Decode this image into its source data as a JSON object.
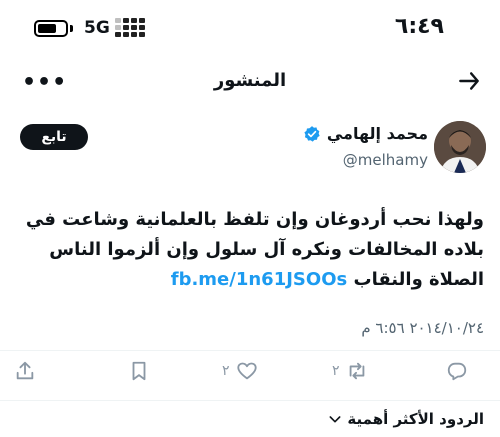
{
  "status_bar": {
    "network": "5G",
    "time": "٦:٤٩"
  },
  "header": {
    "title": "المنشور",
    "more_label": "•••"
  },
  "post": {
    "author_name": "محمد إلهامي",
    "author_handle": "@melhamy",
    "follow_label": "تابع",
    "text": "ولهذا نحب أردوغان وإن تلفظ بالعلمانية وشاعت في بلاده المخالفات ونكره آل سلول وإن ألزموا الناس الصلاة والنقاب",
    "link": "fb.me/1n61JSOOs",
    "date": "٢٠١٤/١٠/٢٤ ٦:٥٦ م"
  },
  "actions": {
    "replies_count": "",
    "retweets_count": "٢",
    "likes_count": "٢"
  },
  "replies": {
    "sort_label": "الردود الأكثر أهمية"
  },
  "colors": {
    "accent": "#1d9bf0",
    "text": "#0f1419",
    "muted": "#536471"
  }
}
